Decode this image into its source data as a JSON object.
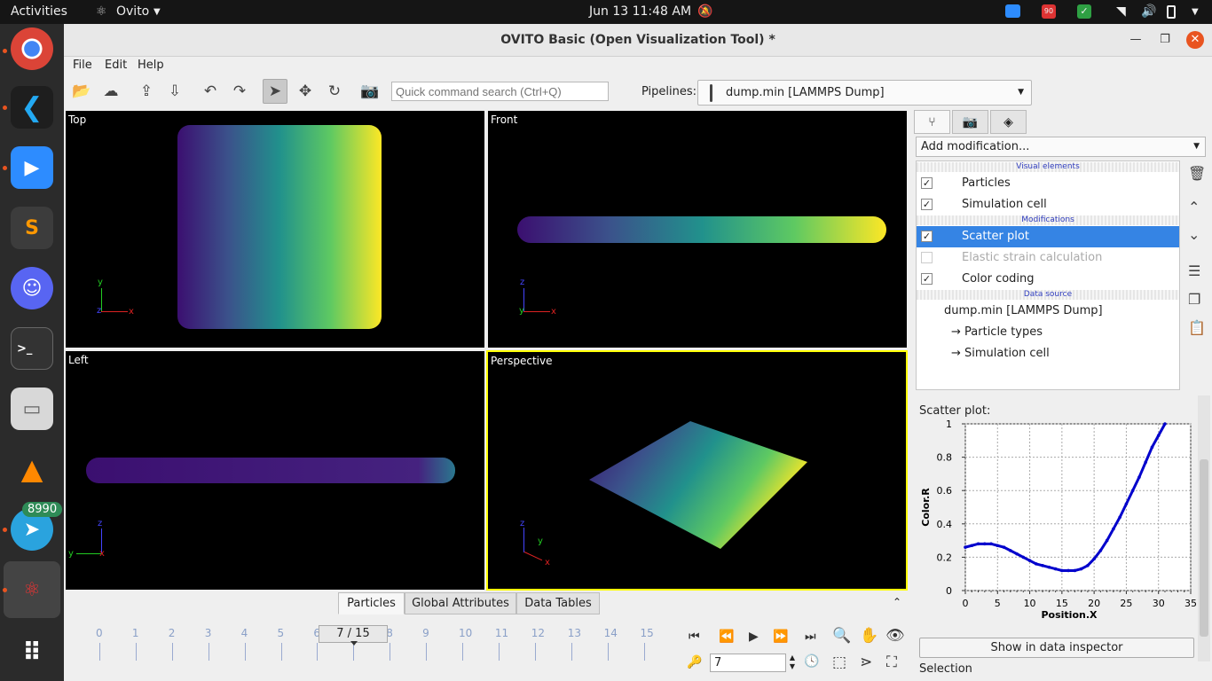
{
  "topbar": {
    "activities": "Activities",
    "app": "Ovito",
    "clock": "Jun 13  11:48 AM",
    "zoom_badge": "90"
  },
  "dock": {
    "telegram_badge": "8990",
    "terminal_label": ">_"
  },
  "window": {
    "title": "OVITO Basic (Open Visualization Tool) *"
  },
  "menu": {
    "file": "File",
    "edit": "Edit",
    "help": "Help"
  },
  "toolbar": {
    "search_placeholder": "Quick command search (Ctrl+Q)",
    "pipelines_label": "Pipelines:",
    "pipeline_value": "dump.min [LAMMPS Dump]"
  },
  "viewports": {
    "top": {
      "caption": "Top",
      "axis_1": "y",
      "axis_2": "z",
      "axis_3": "x"
    },
    "front": {
      "caption": "Front",
      "axis_1": "z",
      "axis_2": "y",
      "axis_3": "x"
    },
    "left": {
      "caption": "Left",
      "axis_1": "z",
      "axis_2": "y",
      "axis_3": "x"
    },
    "perspective": {
      "caption": "Perspective",
      "axis_1": "z",
      "axis_2": "y",
      "axis_3": "x"
    }
  },
  "data_tabs": {
    "particles": "Particles",
    "global": "Global Attributes",
    "tables": "Data Tables"
  },
  "timeline": {
    "ticks": [
      "0",
      "1",
      "2",
      "3",
      "4",
      "5",
      "6",
      "7",
      "8",
      "9",
      "10",
      "11",
      "12",
      "13",
      "14",
      "15"
    ],
    "frame": "7 / 15",
    "spinner": "7"
  },
  "pipeline_panel": {
    "add_modification": "Add modification...",
    "visual_elements": "Visual elements",
    "particles": "Particles",
    "simulation_cell": "Simulation cell",
    "modifications": "Modifications",
    "scatter_plot": "Scatter plot",
    "elastic_strain": "Elastic strain calculation",
    "color_coding": "Color coding",
    "data_source": "Data source",
    "source_name": "dump.min [LAMMPS Dump]",
    "particle_types": "→ Particle types",
    "source_cell": "→ Simulation cell"
  },
  "plot_panel": {
    "label": "Scatter plot:",
    "show_button": "Show in data inspector",
    "selection": "Selection"
  },
  "chart_data": {
    "type": "scatter",
    "xlabel": "Position.X",
    "ylabel": "Color.R",
    "xlim": [
      0,
      35
    ],
    "ylim": [
      0,
      1
    ],
    "xticks": [
      "0",
      "5",
      "10",
      "15",
      "20",
      "25",
      "30",
      "35"
    ],
    "yticks": [
      "0",
      "0.2",
      "0.4",
      "0.6",
      "0.8",
      "1"
    ],
    "grid": true,
    "series": [
      {
        "color": "#0000cc",
        "x": [
          0,
          1,
          2,
          3,
          4,
          5,
          6,
          7,
          8,
          9,
          10,
          11,
          12,
          13,
          14,
          15,
          16,
          17,
          18,
          19,
          20,
          21,
          22,
          23,
          24,
          25,
          26,
          27,
          28,
          29,
          30,
          31
        ],
        "y": [
          0.26,
          0.27,
          0.28,
          0.28,
          0.28,
          0.27,
          0.26,
          0.24,
          0.22,
          0.2,
          0.18,
          0.16,
          0.15,
          0.14,
          0.13,
          0.12,
          0.12,
          0.12,
          0.13,
          0.15,
          0.19,
          0.24,
          0.3,
          0.37,
          0.44,
          0.52,
          0.6,
          0.68,
          0.77,
          0.86,
          0.93,
          1.0
        ]
      }
    ]
  },
  "colors": {
    "accent": "#3584e4",
    "active_viewport": "#ffff00",
    "plot_series": "#0000cc"
  }
}
